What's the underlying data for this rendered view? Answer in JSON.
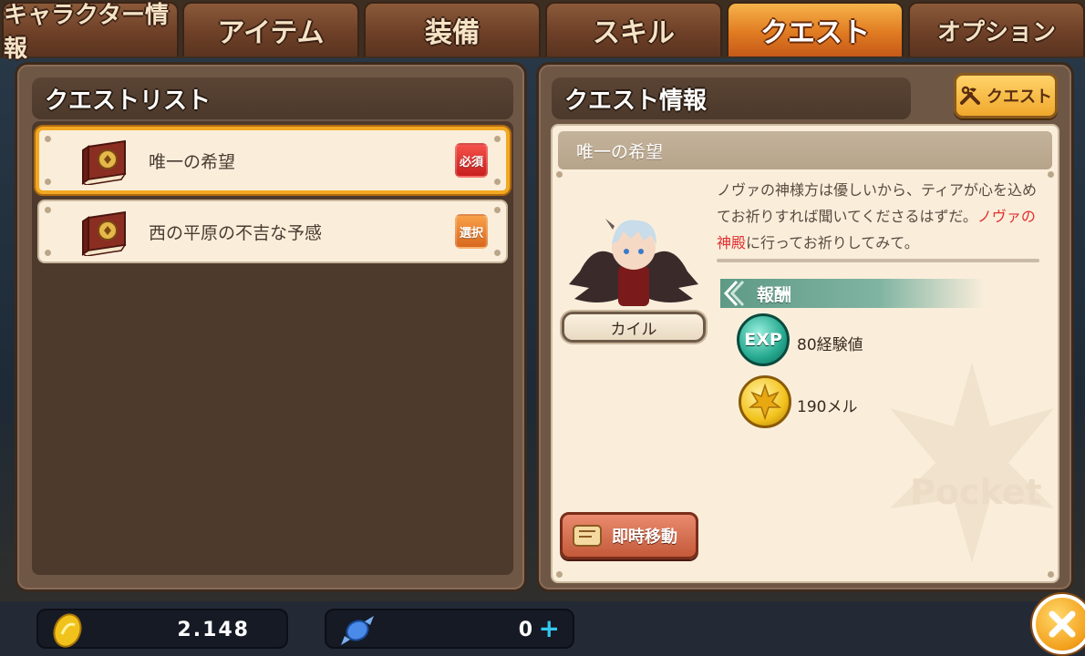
{
  "tabs": [
    {
      "label": "キャラクター情報"
    },
    {
      "label": "アイテム"
    },
    {
      "label": "装備"
    },
    {
      "label": "スキル"
    },
    {
      "label": "クエスト",
      "active": true
    },
    {
      "label": "オプション"
    }
  ],
  "quest_list": {
    "title": "クエストリスト",
    "items": [
      {
        "name": "唯一の希望",
        "badge": "必須",
        "badge_color": "#e0302c",
        "selected": true
      },
      {
        "name": "西の平原の不吉な予感",
        "badge": "選択",
        "badge_color": "#e8802e",
        "selected": false
      }
    ]
  },
  "quest_info": {
    "title": "クエスト情報",
    "quest_button_label": "クエスト",
    "quest_name": "唯一の希望",
    "description_before": "ノヴァの神様方は優しいから、ティアが心を込めてお祈りすれば聞いてくださるはずだ。",
    "description_highlight": "ノヴァの神殿",
    "description_after": "に行ってお祈りしてみて。",
    "npc_name": "カイル",
    "reward_header": "報酬",
    "rewards": [
      {
        "icon": "exp-icon",
        "icon_label": "EXP",
        "text": "80経験値"
      },
      {
        "icon": "meso-coin-icon",
        "text": "190メル"
      }
    ],
    "instant_move_label": "即時移動",
    "watermark": "Pocket"
  },
  "bottom_bar": {
    "gold": "2.148",
    "candy": "0"
  },
  "colors": {
    "accent_orange": "#f0a82c",
    "required_red": "#e0302c",
    "optional_orange": "#e8802e",
    "reward_teal": "#5e9a86"
  }
}
